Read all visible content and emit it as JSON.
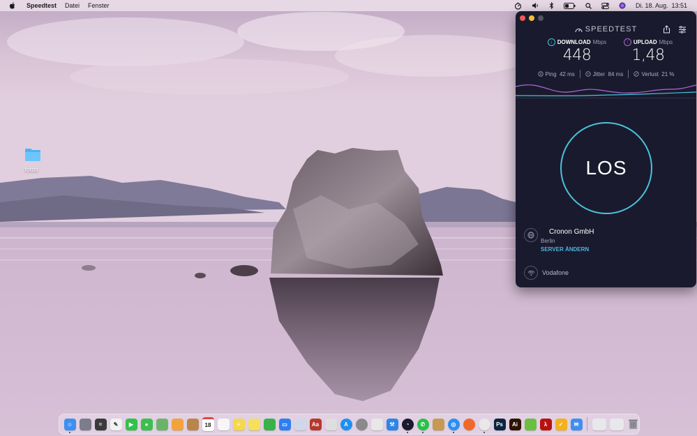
{
  "menubar": {
    "app_name": "Speedtest",
    "menus": [
      "Datei",
      "Fenster"
    ],
    "clock": "Di. 18. Aug.  13:51"
  },
  "desktop": {
    "icons": [
      {
        "label": "fotos",
        "icon": "folder-icon"
      }
    ]
  },
  "speedtest": {
    "brand": "SPEEDTEST",
    "download": {
      "label": "DOWNLOAD",
      "unit": "Mbps",
      "value": "448"
    },
    "upload": {
      "label": "UPLOAD",
      "unit": "Mbps",
      "value": "1,48"
    },
    "ping": "Ping  42 ms",
    "jitter": "Jitter  84 ms",
    "loss": "Verlust  21 %",
    "go_button": "LOS",
    "server": {
      "name": "Cronon GmbH",
      "city": "Berlin",
      "change_label": "SERVER ÄNDERN"
    },
    "provider": "Vodafone",
    "colors": {
      "accent": "#49c4d8",
      "upload": "#b266d9",
      "background": "#1a1a2e",
      "link": "#49b6e0"
    }
  },
  "dock": {
    "calendar_date": "18",
    "apps": [
      {
        "name": "finder",
        "color": "#3d8ff0"
      },
      {
        "name": "launchpad",
        "color": "#7c7c8c"
      },
      {
        "name": "calculator",
        "color": "#3a3a3a"
      },
      {
        "name": "textedit",
        "color": "#f2f2f2"
      },
      {
        "name": "facetime",
        "color": "#33c14b"
      },
      {
        "name": "messages",
        "color": "#3bc04e"
      },
      {
        "name": "maps",
        "color": "#6ab46a"
      },
      {
        "name": "photos",
        "color": "#f3a33b"
      },
      {
        "name": "contacts",
        "color": "#b8864a"
      },
      {
        "name": "calendar",
        "color": "#ffffff"
      },
      {
        "name": "reminders",
        "color": "#f6f6f6"
      },
      {
        "name": "notes",
        "color": "#f6d84c"
      },
      {
        "name": "stickies",
        "color": "#f4e05a"
      },
      {
        "name": "numbers",
        "color": "#3bb14a"
      },
      {
        "name": "keynote",
        "color": "#2d7ff0"
      },
      {
        "name": "preview",
        "color": "#cfd8e8"
      },
      {
        "name": "dictionary",
        "color": "#b6392c"
      },
      {
        "name": "script-editor",
        "color": "#dedede"
      },
      {
        "name": "app-store",
        "color": "#1e8ff5"
      },
      {
        "name": "system-preferences",
        "color": "#8a8a8a"
      },
      {
        "name": "textwrangler",
        "color": "#e8e8e8"
      },
      {
        "name": "xcode",
        "color": "#2d86e6"
      },
      {
        "name": "speedtest",
        "color": "#1a1a2e"
      },
      {
        "name": "whatsapp",
        "color": "#28c148"
      },
      {
        "name": "archive-utility",
        "color": "#c59a51"
      },
      {
        "name": "safari",
        "color": "#2a8ff5"
      },
      {
        "name": "firefox",
        "color": "#ef6a2a"
      },
      {
        "name": "chrome",
        "color": "#e8e8e8"
      },
      {
        "name": "photoshop",
        "color": "#0a2540"
      },
      {
        "name": "illustrator",
        "color": "#2d1300"
      },
      {
        "name": "keychain",
        "color": "#6bbf3f"
      },
      {
        "name": "acrobat",
        "color": "#b9120e"
      },
      {
        "name": "taskmanager",
        "color": "#f3b21d"
      },
      {
        "name": "mail",
        "color": "#3f8ff0"
      }
    ]
  }
}
